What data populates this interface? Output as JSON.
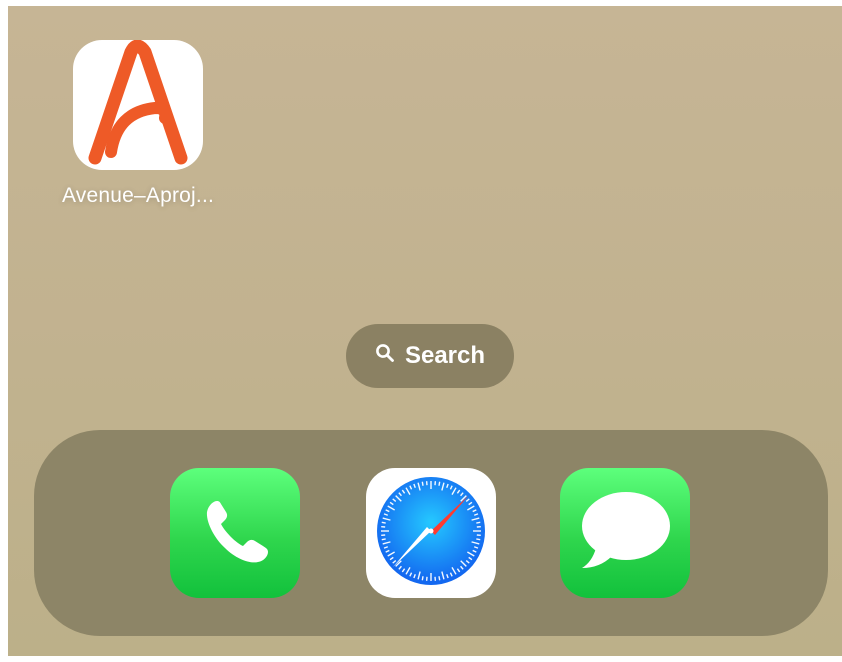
{
  "home": {
    "apps": [
      {
        "label": "Avenue–Aproj...",
        "icon": "avenue-a-icon",
        "accent": "#ee5a27"
      }
    ]
  },
  "search": {
    "label": "Search",
    "icon": "magnifier-icon"
  },
  "dock": {
    "apps": [
      {
        "icon": "phone-icon",
        "color": "#2fd64d"
      },
      {
        "icon": "safari-compass-icon",
        "color": "#1a8cf5"
      },
      {
        "icon": "messages-bubble-icon",
        "color": "#2fd64d"
      }
    ]
  }
}
